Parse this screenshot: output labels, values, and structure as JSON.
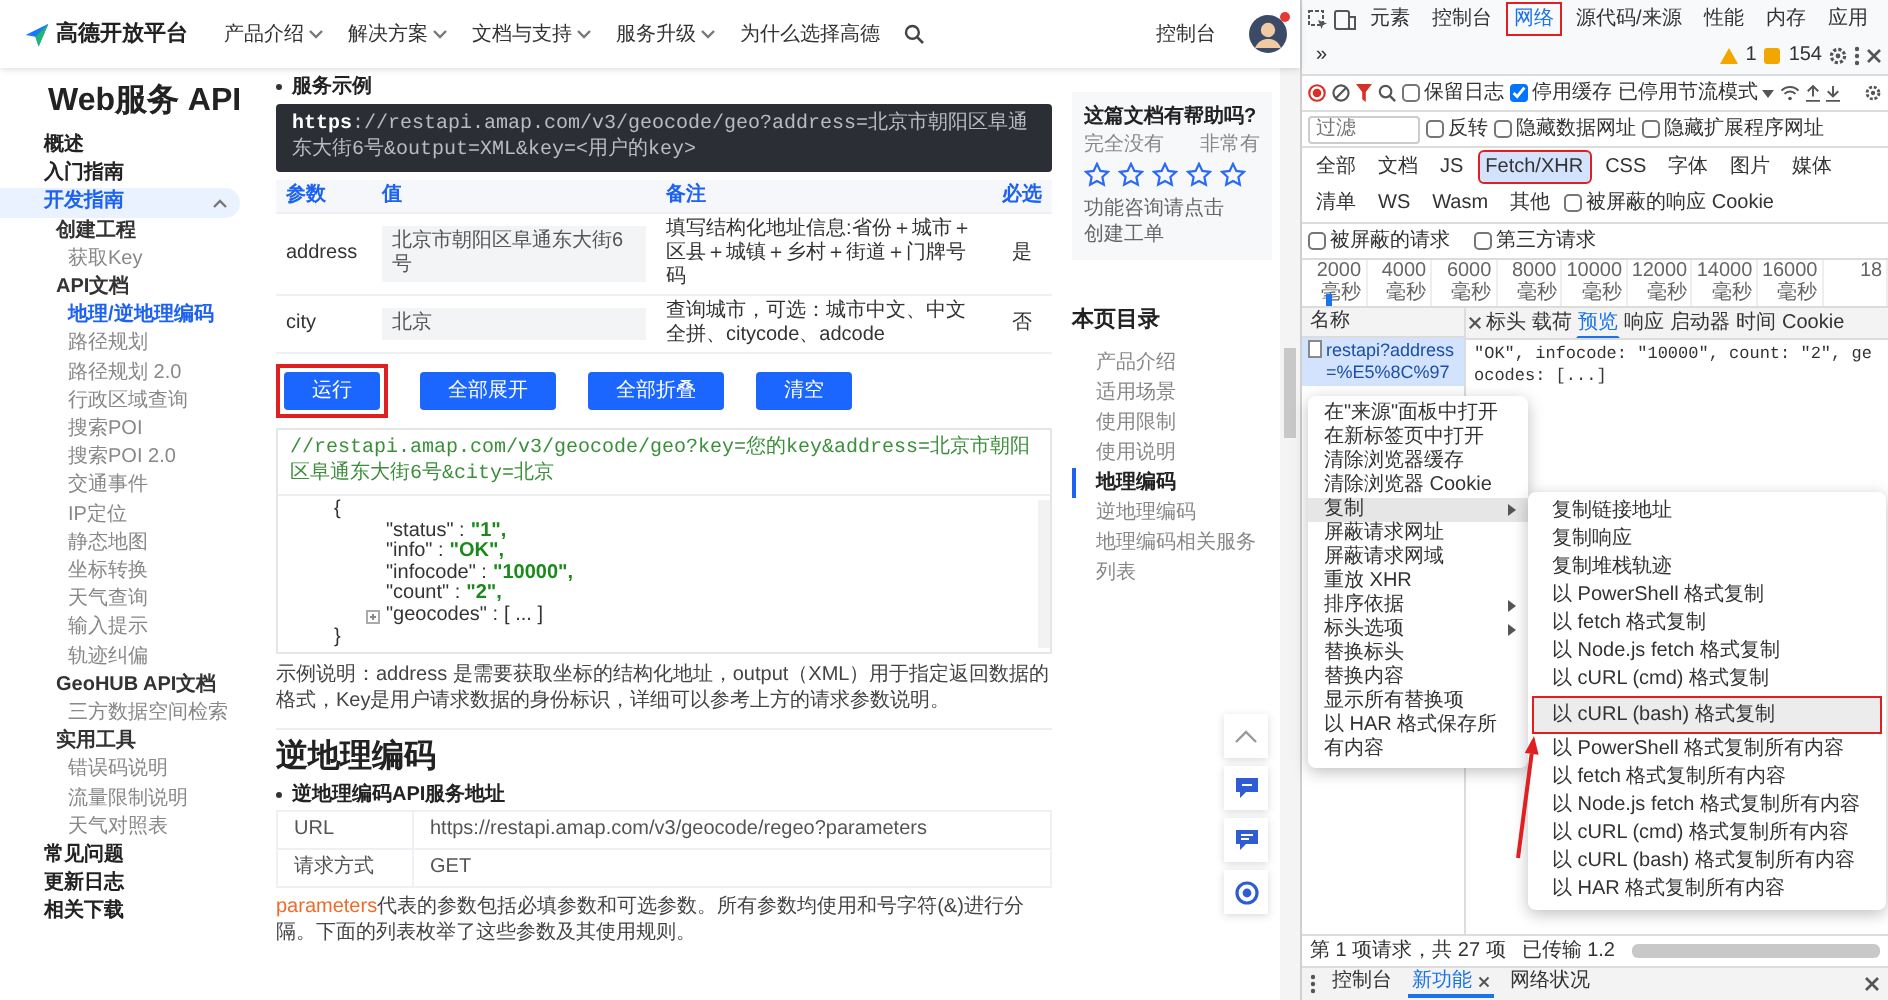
{
  "header": {
    "logo": "高德开放平台",
    "nav": [
      {
        "label": "产品介绍",
        "dropdown": true
      },
      {
        "label": "解决方案",
        "dropdown": true
      },
      {
        "label": "文档与支持",
        "dropdown": true
      },
      {
        "label": "服务升级",
        "dropdown": true
      },
      {
        "label": "为什么选择高德",
        "dropdown": false
      }
    ],
    "console": "控制台",
    "notification": true
  },
  "sidebar": {
    "title": "Web服务 API",
    "items": [
      {
        "label": "概述",
        "selected": false
      },
      {
        "label": "入门指南",
        "selected": false
      },
      {
        "label": "开发指南",
        "selected": true,
        "expanded": true,
        "children": [
          {
            "label": "创建工程",
            "selected": false,
            "children": [
              {
                "label": "获取Key",
                "selected": false
              }
            ]
          },
          {
            "label": "API文档",
            "selected": false,
            "children": [
              {
                "label": "地理/逆地理编码",
                "selected": true
              },
              {
                "label": "路径规划",
                "selected": false
              },
              {
                "label": "路径规划 2.0",
                "selected": false
              },
              {
                "label": "行政区域查询",
                "selected": false
              },
              {
                "label": "搜索POI",
                "selected": false
              },
              {
                "label": "搜索POI 2.0",
                "selected": false
              },
              {
                "label": "交通事件",
                "selected": false
              },
              {
                "label": "IP定位",
                "selected": false
              },
              {
                "label": "静态地图",
                "selected": false
              },
              {
                "label": "坐标转换",
                "selected": false
              },
              {
                "label": "天气查询",
                "selected": false
              },
              {
                "label": "输入提示",
                "selected": false
              },
              {
                "label": "轨迹纠偏",
                "selected": false
              }
            ]
          },
          {
            "label": "GeoHUB API文档",
            "selected": false,
            "children": [
              {
                "label": "三方数据空间检索",
                "selected": false
              }
            ]
          },
          {
            "label": "实用工具",
            "selected": false,
            "children": [
              {
                "label": "错误码说明",
                "selected": false
              },
              {
                "label": "流量限制说明",
                "selected": false
              },
              {
                "label": "天气对照表",
                "selected": false
              }
            ]
          }
        ]
      },
      {
        "label": "常见问题",
        "selected": false
      },
      {
        "label": "更新日志",
        "selected": false
      },
      {
        "label": "相关下载",
        "selected": false
      }
    ]
  },
  "example": {
    "bullet": "服务示例",
    "request_url_scheme": "https",
    "request_url": "://restapi.amap.com/v3/geocode/geo?address=北京市朝阳区阜通东大街6号&output=XML&key=<用户的key>",
    "params": {
      "columns": [
        "参数",
        "值",
        "备注",
        "必选"
      ],
      "rows": [
        {
          "name": "address",
          "value": "北京市朝阳区阜通东大街6号",
          "note": "填写结构化地址信息:省份＋城市＋区县＋城镇＋乡村＋街道＋门牌号码",
          "required": "是"
        },
        {
          "name": "city",
          "value": "北京",
          "note": "查询城市，可选：城市中文、中文全拼、citycode、adcode",
          "required": "否"
        }
      ]
    },
    "buttons": [
      {
        "label": "运行",
        "highlighted": true
      },
      {
        "label": "全部展开",
        "highlighted": false
      },
      {
        "label": "全部折叠",
        "highlighted": false
      },
      {
        "label": "清空",
        "highlighted": false
      }
    ],
    "result": {
      "url": "//restapi.amap.com/v3/geocode/geo?key=您的key&address=北京市朝阳区阜通东大街6号&city=北京",
      "lines": [
        {
          "kind": "brace",
          "text": "{"
        },
        {
          "kind": "pair",
          "key": "\"status\" :",
          "value": "\"1\","
        },
        {
          "kind": "pair",
          "key": "\"info\" :",
          "value": "\"OK\","
        },
        {
          "kind": "pair",
          "key": "\"infocode\" :",
          "value": "\"10000\","
        },
        {
          "kind": "pair",
          "key": "\"count\" :",
          "value": "\"2\","
        },
        {
          "kind": "folded",
          "key": "\"geocodes\" :",
          "value": "[ ... ]"
        },
        {
          "kind": "brace",
          "text": "}"
        }
      ]
    },
    "description": "示例说明：address 是需要获取坐标的结构化地址，output（XML）用于指定返回数据的格式，Key是用户请求数据的身份标识，详细可以参考上方的请求参数说明。"
  },
  "reverse": {
    "heading": "逆地理编码",
    "bullet": "逆地理编码API服务地址",
    "rows": [
      {
        "label": "URL",
        "value": "https://restapi.amap.com/v3/geocode/regeo?parameters"
      },
      {
        "label": "请求方式",
        "value": "GET"
      }
    ],
    "note_lead": "parameters",
    "note": "代表的参数包括必填参数和可选参数。所有参数均使用和号字符(&)进行分隔。下面的列表枚举了这些参数及其使用规则。"
  },
  "feedback": {
    "question": "这篇文档有帮助吗?",
    "low": "完全没有",
    "high": "非常有",
    "stars": 0,
    "hint": "功能咨询请点击",
    "link": "创建工单"
  },
  "toc": {
    "title": "本页目录",
    "items": [
      {
        "label": "产品介绍",
        "selected": false
      },
      {
        "label": "适用场景",
        "selected": false
      },
      {
        "label": "使用限制",
        "selected": false
      },
      {
        "label": "使用说明",
        "selected": false
      },
      {
        "label": "地理编码",
        "selected": true
      },
      {
        "label": "逆地理编码",
        "selected": false
      },
      {
        "label": "地理编码相关服务列表",
        "selected": false
      }
    ]
  },
  "devtools": {
    "tabs": [
      {
        "label": "元素",
        "selected": false,
        "highlighted": false
      },
      {
        "label": "控制台",
        "selected": false,
        "highlighted": false
      },
      {
        "label": "网络",
        "selected": true,
        "highlighted": true
      },
      {
        "label": "源代码/来源",
        "selected": false,
        "highlighted": false
      },
      {
        "label": "性能",
        "selected": false,
        "highlighted": false
      },
      {
        "label": "内存",
        "selected": false,
        "highlighted": false
      },
      {
        "label": "应用",
        "selected": false,
        "highlighted": false
      }
    ],
    "more": "»",
    "warnings": "1",
    "issues": "154",
    "preserve_log": {
      "label": "保留日志",
      "checked": false
    },
    "disable_cache": {
      "label": "停用缓存",
      "checked": true
    },
    "throttling": "已停用节流模式",
    "filter": {
      "placeholder": "过滤",
      "options": [
        {
          "label": "反转",
          "checked": false
        },
        {
          "label": "隐藏数据网址",
          "checked": false
        },
        {
          "label": "隐藏扩展程序网址",
          "checked": false
        }
      ]
    },
    "types": [
      {
        "label": "全部",
        "selected": false,
        "highlighted": false
      },
      {
        "label": "文档",
        "selected": false,
        "highlighted": false
      },
      {
        "label": "JS",
        "selected": false,
        "highlighted": false
      },
      {
        "label": "Fetch/XHR",
        "selected": true,
        "highlighted": true
      },
      {
        "label": "CSS",
        "selected": false,
        "highlighted": false
      },
      {
        "label": "字体",
        "selected": false,
        "highlighted": false
      },
      {
        "label": "图片",
        "selected": false,
        "highlighted": false
      },
      {
        "label": "媒体",
        "selected": false,
        "highlighted": false
      },
      {
        "label": "清单",
        "selected": false,
        "highlighted": false
      },
      {
        "label": "WS",
        "selected": false,
        "highlighted": false
      },
      {
        "label": "Wasm",
        "selected": false,
        "highlighted": false
      },
      {
        "label": "其他",
        "selected": false,
        "highlighted": false
      }
    ],
    "type_options": [
      {
        "label": "被屏蔽的响应 Cookie",
        "checked": false
      }
    ],
    "request_options": [
      {
        "label": "被屏蔽的请求",
        "checked": false
      },
      {
        "label": "第三方请求",
        "checked": false
      }
    ],
    "timeline_ticks": [
      "2000 毫秒",
      "4000 毫秒",
      "6000 毫秒",
      "8000 毫秒",
      "10000 毫秒",
      "12000 毫秒",
      "14000 毫秒",
      "16000 毫秒",
      "18"
    ],
    "requests": {
      "column": "名称",
      "rows": [
        {
          "name": "restapi?address=%E5%8C%97",
          "selected": true
        }
      ]
    },
    "detail_tabs": [
      {
        "label": "标头",
        "selected": false
      },
      {
        "label": "载荷",
        "selected": false
      },
      {
        "label": "预览",
        "selected": true
      },
      {
        "label": "响应",
        "selected": false
      },
      {
        "label": "启动器",
        "selected": false
      },
      {
        "label": "时间",
        "selected": false
      },
      {
        "label": "Cookie",
        "selected": false
      }
    ],
    "detail_text": "\"OK\", infocode: \"10000\", count: \"2\", geocodes: [...]",
    "context_menu": [
      {
        "label": "在\"来源\"面板中打开",
        "kind": "item",
        "selected": false
      },
      {
        "label": "在新标签页中打开",
        "kind": "item",
        "selected": false
      },
      {
        "label": "清除浏览器缓存",
        "kind": "item",
        "selected": false
      },
      {
        "label": "清除浏览器 Cookie",
        "kind": "item",
        "selected": false
      },
      {
        "label": "复制",
        "kind": "submenu",
        "selected": true
      },
      {
        "label": "屏蔽请求网址",
        "kind": "item",
        "selected": false
      },
      {
        "label": "屏蔽请求网域",
        "kind": "item",
        "selected": false
      },
      {
        "label": "重放 XHR",
        "kind": "item",
        "selected": false
      },
      {
        "label": "排序依据",
        "kind": "submenu",
        "selected": false
      },
      {
        "label": "标头选项",
        "kind": "submenu",
        "selected": false
      },
      {
        "label": "替换标头",
        "kind": "item",
        "selected": false
      },
      {
        "label": "替换内容",
        "kind": "item",
        "selected": false
      },
      {
        "label": "显示所有替换项",
        "kind": "item",
        "selected": false
      },
      {
        "label": "以 HAR 格式保存所有内容",
        "kind": "item",
        "selected": false
      }
    ],
    "copy_menu": [
      {
        "label": "复制链接地址",
        "highlighted": false
      },
      {
        "label": "复制响应",
        "highlighted": false
      },
      {
        "label": "复制堆栈轨迹",
        "highlighted": false
      },
      {
        "label": "以 PowerShell 格式复制",
        "highlighted": false
      },
      {
        "label": "以 fetch 格式复制",
        "highlighted": false
      },
      {
        "label": "以 Node.js fetch 格式复制",
        "highlighted": false
      },
      {
        "label": "以 cURL (cmd) 格式复制",
        "highlighted": false
      },
      {
        "label": "以 cURL (bash) 格式复制",
        "highlighted": true
      },
      {
        "label": "以 PowerShell 格式复制所有内容",
        "highlighted": false
      },
      {
        "label": "以 fetch 格式复制所有内容",
        "highlighted": false
      },
      {
        "label": "以 Node.js fetch 格式复制所有内容",
        "highlighted": false
      },
      {
        "label": "以 cURL (cmd) 格式复制所有内容",
        "highlighted": false
      },
      {
        "label": "以 cURL (bash) 格式复制所有内容",
        "highlighted": false
      },
      {
        "label": "以 HAR 格式复制所有内容",
        "highlighted": false
      }
    ],
    "status": [
      "第 1 项请求，共 27 项",
      "已传输 1.2"
    ],
    "drawer_tabs": [
      {
        "label": "控制台",
        "selected": false,
        "closable": false
      },
      {
        "label": "新功能",
        "selected": true,
        "closable": true
      },
      {
        "label": "网络状况",
        "selected": false,
        "closable": false
      }
    ]
  }
}
